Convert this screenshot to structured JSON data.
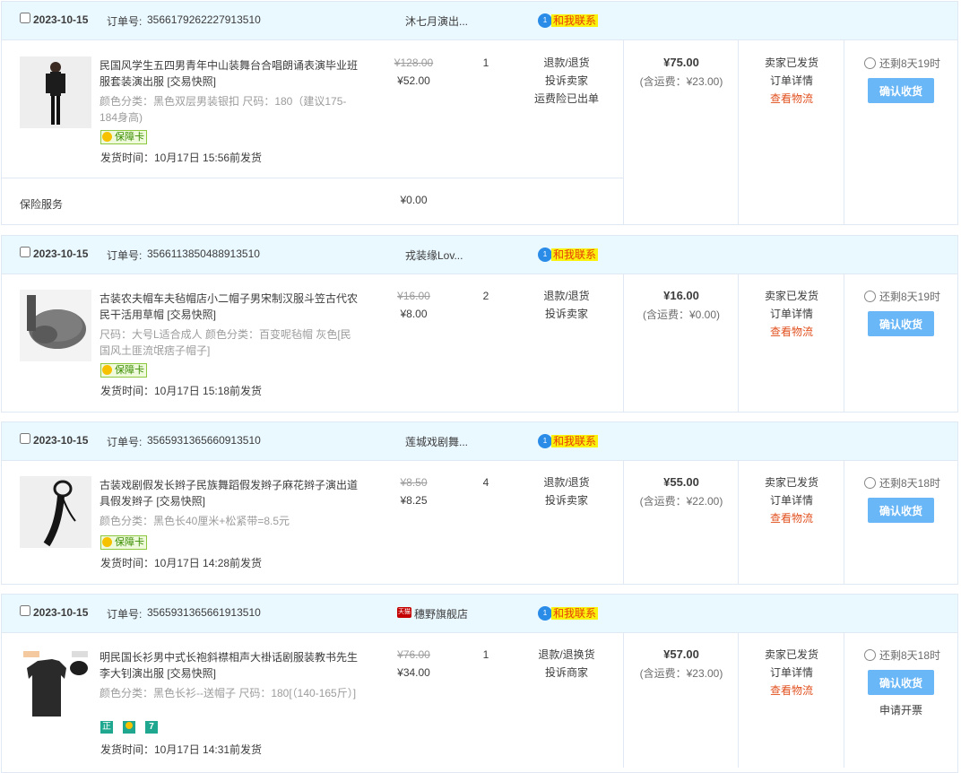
{
  "labels": {
    "order_no": "订单号:",
    "contact": "和我联系",
    "confirm": "确认收货",
    "tmall": "天猫",
    "bubble": "1"
  },
  "colors": {
    "header_bg": "#eaf8ff",
    "border": "#dfe8f3",
    "confirm_btn": "#6ab7f7",
    "track_link": "#e1501f",
    "contact_bg": "#f9f20c"
  },
  "orders": [
    {
      "date": "2023-10-15",
      "order_id": "3566179262227913510",
      "shop": "沐七月演出...",
      "item": {
        "title": "民国风学生五四男青年中山装舞台合唱朗诵表演毕业班服套装演出服 [交易快照]",
        "attrs": "颜色分类：黑色双层男装银扣  尺码：180（建议175-184身高)",
        "badge": "保障卡",
        "ship_time": "发货时间：10月17日 15:56前发货",
        "orig_price": "¥128.00",
        "price": "¥52.00",
        "qty": "1",
        "after_sale": [
          "退款/退货",
          "投诉卖家",
          "运费险已出单"
        ]
      },
      "insurance": {
        "label": "保险服务",
        "price": "¥0.00"
      },
      "total": "¥75.00",
      "shipping_note": "(含运费：¥23.00)",
      "status": [
        "卖家已发货",
        "订单详情",
        "查看物流"
      ],
      "remaining": "还剩8天19时",
      "thumb_icon": "product-image-suit"
    },
    {
      "date": "2023-10-15",
      "order_id": "3566113850488913510",
      "shop": "戎装缘Lov...",
      "item": {
        "title": "古装农夫帽车夫毡帽店小二帽子男宋制汉服斗笠古代农民干活用草帽 [交易快照]",
        "attrs": "尺码：大号L适合成人  颜色分类：百变呢毡帽 灰色[民国风土匪流氓痞子帽子]",
        "badge": "保障卡",
        "ship_time": "发货时间：10月17日 15:18前发货",
        "orig_price": "¥16.00",
        "price": "¥8.00",
        "qty": "2",
        "after_sale": [
          "退款/退货",
          "投诉卖家"
        ]
      },
      "total": "¥16.00",
      "shipping_note": "(含运费：¥0.00)",
      "status": [
        "卖家已发货",
        "订单详情",
        "查看物流"
      ],
      "remaining": "还剩8天19时",
      "thumb_icon": "product-image-hat"
    },
    {
      "date": "2023-10-15",
      "order_id": "3565931365660913510",
      "shop": "莲城戏剧舞...",
      "item": {
        "title": "古装戏剧假发长辫子民族舞蹈假发辫子麻花辫子演出道具假发辫子 [交易快照]",
        "attrs": "颜色分类：黑色长40厘米+松紧带=8.5元",
        "badge": "保障卡",
        "ship_time": "发货时间：10月17日 14:28前发货",
        "orig_price": "¥8.50",
        "price": "¥8.25",
        "qty": "4",
        "after_sale": [
          "退款/退货",
          "投诉卖家"
        ]
      },
      "total": "¥55.00",
      "shipping_note": "(含运费：¥22.00)",
      "status": [
        "卖家已发货",
        "订单详情",
        "查看物流"
      ],
      "remaining": "还剩8天18时",
      "thumb_icon": "product-image-braid"
    },
    {
      "date": "2023-10-15",
      "order_id": "3565931365661913510",
      "shop": "穗野旗舰店",
      "item": {
        "title": "明民国长衫男中式长袍斜襟相声大褂话剧服装教书先生李大钊演出服 [交易快照]",
        "attrs": "颜色分类：黑色长衫--送帽子  尺码：180[（140-165斤）]",
        "icons": [
          "正",
          "7"
        ],
        "ship_time": "发货时间：10月17日 14:31前发货",
        "orig_price": "¥76.00",
        "price": "¥34.00",
        "qty": "1",
        "after_sale": [
          "退款/退换货",
          "投诉商家"
        ]
      },
      "total": "¥57.00",
      "shipping_note": "(含运费：¥23.00)",
      "status": [
        "卖家已发货",
        "订单详情",
        "查看物流"
      ],
      "remaining": "还剩8天18时",
      "invoice": "申请开票",
      "thumb_icon": "product-image-robe"
    }
  ]
}
